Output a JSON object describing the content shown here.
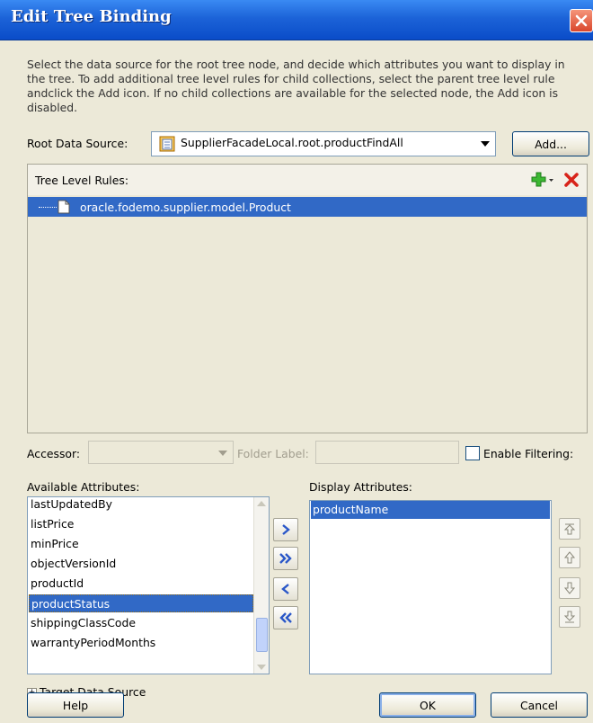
{
  "window": {
    "title": "Edit Tree Binding"
  },
  "description": "Select the data source for the root tree node, and decide which attributes you want to display in the tree. To add additional tree level rules for child collections, select the parent tree level rule andclick the Add icon. If no child collections are available for the selected node, the Add icon is disabled.",
  "root_data_source": {
    "label": "Root Data Source:",
    "value": "SupplierFacadeLocal.root.productFindAll",
    "add_button": "Add..."
  },
  "tree_level_rules": {
    "header": "Tree Level Rules:",
    "items": [
      "oracle.fodemo.supplier.model.Product"
    ]
  },
  "accessor": {
    "label": "Accessor:",
    "value": ""
  },
  "folder_label": {
    "label": "Folder Label:",
    "value": ""
  },
  "enable_filtering": {
    "label": "Enable Filtering:",
    "checked": false
  },
  "available_attributes": {
    "label": "Available Attributes:",
    "items": [
      "lastUpdatedBy",
      "listPrice",
      "minPrice",
      "objectVersionId",
      "productId",
      "productStatus",
      "shippingClassCode",
      "warrantyPeriodMonths"
    ],
    "selected": "productStatus"
  },
  "display_attributes": {
    "label": "Display Attributes:",
    "items": [
      "productName"
    ],
    "selected": "productName"
  },
  "target_data_source": {
    "label": "Target Data Source",
    "expanded": false
  },
  "buttons": {
    "help": "Help",
    "ok": "OK",
    "cancel": "Cancel"
  },
  "colors": {
    "titlebar": "#0a4cc8",
    "selection": "#3169c6",
    "dialog_bg": "#ece9d8"
  }
}
